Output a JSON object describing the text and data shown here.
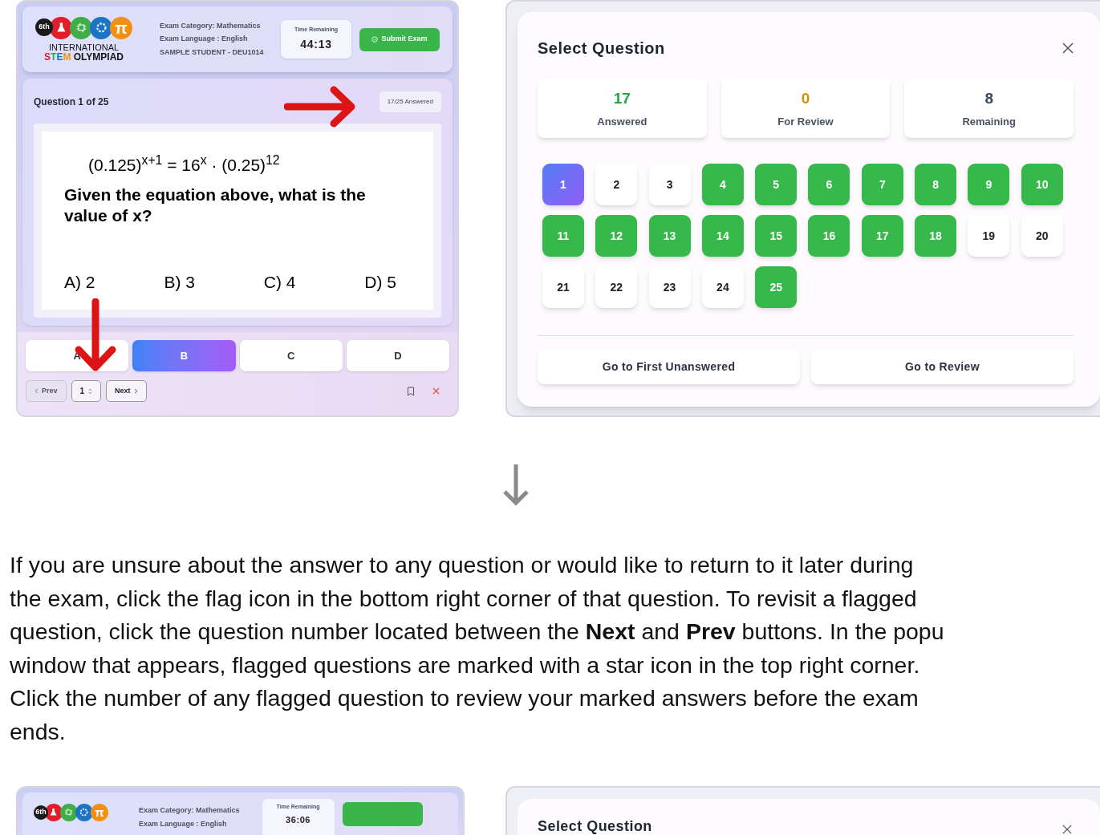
{
  "exam_screen": {
    "logo": {
      "badge": "6th",
      "symbol": "π",
      "line1": "INTERNATIONAL",
      "line2": [
        {
          "text": "S",
          "color": "#e11d2a"
        },
        {
          "text": "T",
          "color": "#2fa84f"
        },
        {
          "text": "E",
          "color": "#1d74c4"
        },
        {
          "text": "M",
          "color": "#f29111"
        },
        {
          "text": " OLYMPIAD",
          "color": "#111111"
        }
      ]
    },
    "info": [
      "Exam Category: Mathematics",
      "Exam Language : English",
      "SAMPLE STUDENT - DEU1014"
    ],
    "timer": {
      "label": "Time Remaining",
      "value": "44:13"
    },
    "submit_button": "Submit Exam",
    "question_header": "Question 1 of 25",
    "answered_badge": "17/25 Answered",
    "equation": "(0.125)$^{x+1}$ = 16$^{x}$ · (0.25)$^{12}$",
    "question": "Given the equation above, what is the value of x?",
    "options": [
      "A) 2",
      "B) 3",
      "C) 4",
      "D) 5"
    ],
    "answer_buttons": [
      {
        "label": "A",
        "selected": false
      },
      {
        "label": "B",
        "selected": true
      },
      {
        "label": "C",
        "selected": false
      },
      {
        "label": "D",
        "selected": false
      }
    ],
    "nav": {
      "prev": "Prev",
      "number": "1",
      "next": "Next"
    }
  },
  "question_picker": {
    "title": "Select Question",
    "stats": [
      {
        "value": "17",
        "label": "Answered",
        "color": "#22a745"
      },
      {
        "value": "0",
        "label": "For Review",
        "color": "#d4900a"
      },
      {
        "value": "8",
        "label": "Remaining",
        "color": "#3b4556"
      }
    ],
    "questions": [
      {
        "number": "1",
        "selected": true,
        "answered": false
      },
      {
        "number": "2",
        "selected": false,
        "answered": false
      },
      {
        "number": "3",
        "selected": false,
        "answered": false
      },
      {
        "number": "4",
        "selected": false,
        "answered": true
      },
      {
        "number": "5",
        "selected": false,
        "answered": true
      },
      {
        "number": "6",
        "selected": false,
        "answered": true
      },
      {
        "number": "7",
        "selected": false,
        "answered": true
      },
      {
        "number": "8",
        "selected": false,
        "answered": true
      },
      {
        "number": "9",
        "selected": false,
        "answered": true
      },
      {
        "number": "10",
        "selected": false,
        "answered": true
      },
      {
        "number": "11",
        "selected": false,
        "answered": true
      },
      {
        "number": "12",
        "selected": false,
        "answered": true
      },
      {
        "number": "13",
        "selected": false,
        "answered": true
      },
      {
        "number": "14",
        "selected": false,
        "answered": true
      },
      {
        "number": "15",
        "selected": false,
        "answered": true
      },
      {
        "number": "16",
        "selected": false,
        "answered": true
      },
      {
        "number": "17",
        "selected": false,
        "answered": true
      },
      {
        "number": "18",
        "selected": false,
        "answered": true
      },
      {
        "number": "19",
        "selected": false,
        "answered": false
      },
      {
        "number": "20",
        "selected": false,
        "answered": false
      },
      {
        "number": "21",
        "selected": false,
        "answered": false
      },
      {
        "number": "22",
        "selected": false,
        "answered": false
      },
      {
        "number": "23",
        "selected": false,
        "answered": false
      },
      {
        "number": "24",
        "selected": false,
        "answered": false
      },
      {
        "number": "25",
        "selected": false,
        "answered": true
      }
    ],
    "buttons": [
      "Go to First Unanswered",
      "Go to Review"
    ]
  },
  "instructions": [
    "If you are unsure about the answer to any question or would like to return to it later during",
    "the exam, click the flag icon in the bottom right corner of that question. To revisit a flagged",
    "question, click the question number located between the **Next** and **Prev** buttons. In the popu",
    "window that appears, flagged questions are marked with a star icon in the top right corner.",
    "Click the number of any flagged question to review your marked answers before the exam",
    "ends."
  ],
  "second_exam_screen": {
    "logo": {
      "badge": "6th",
      "symbol": "π"
    },
    "info": [
      "Exam Category: Mathematics",
      "Exam Language : English"
    ],
    "timer_label": "Time Remaining",
    "timer_value": "36:06"
  },
  "second_picker": {
    "title": "Select Question"
  }
}
